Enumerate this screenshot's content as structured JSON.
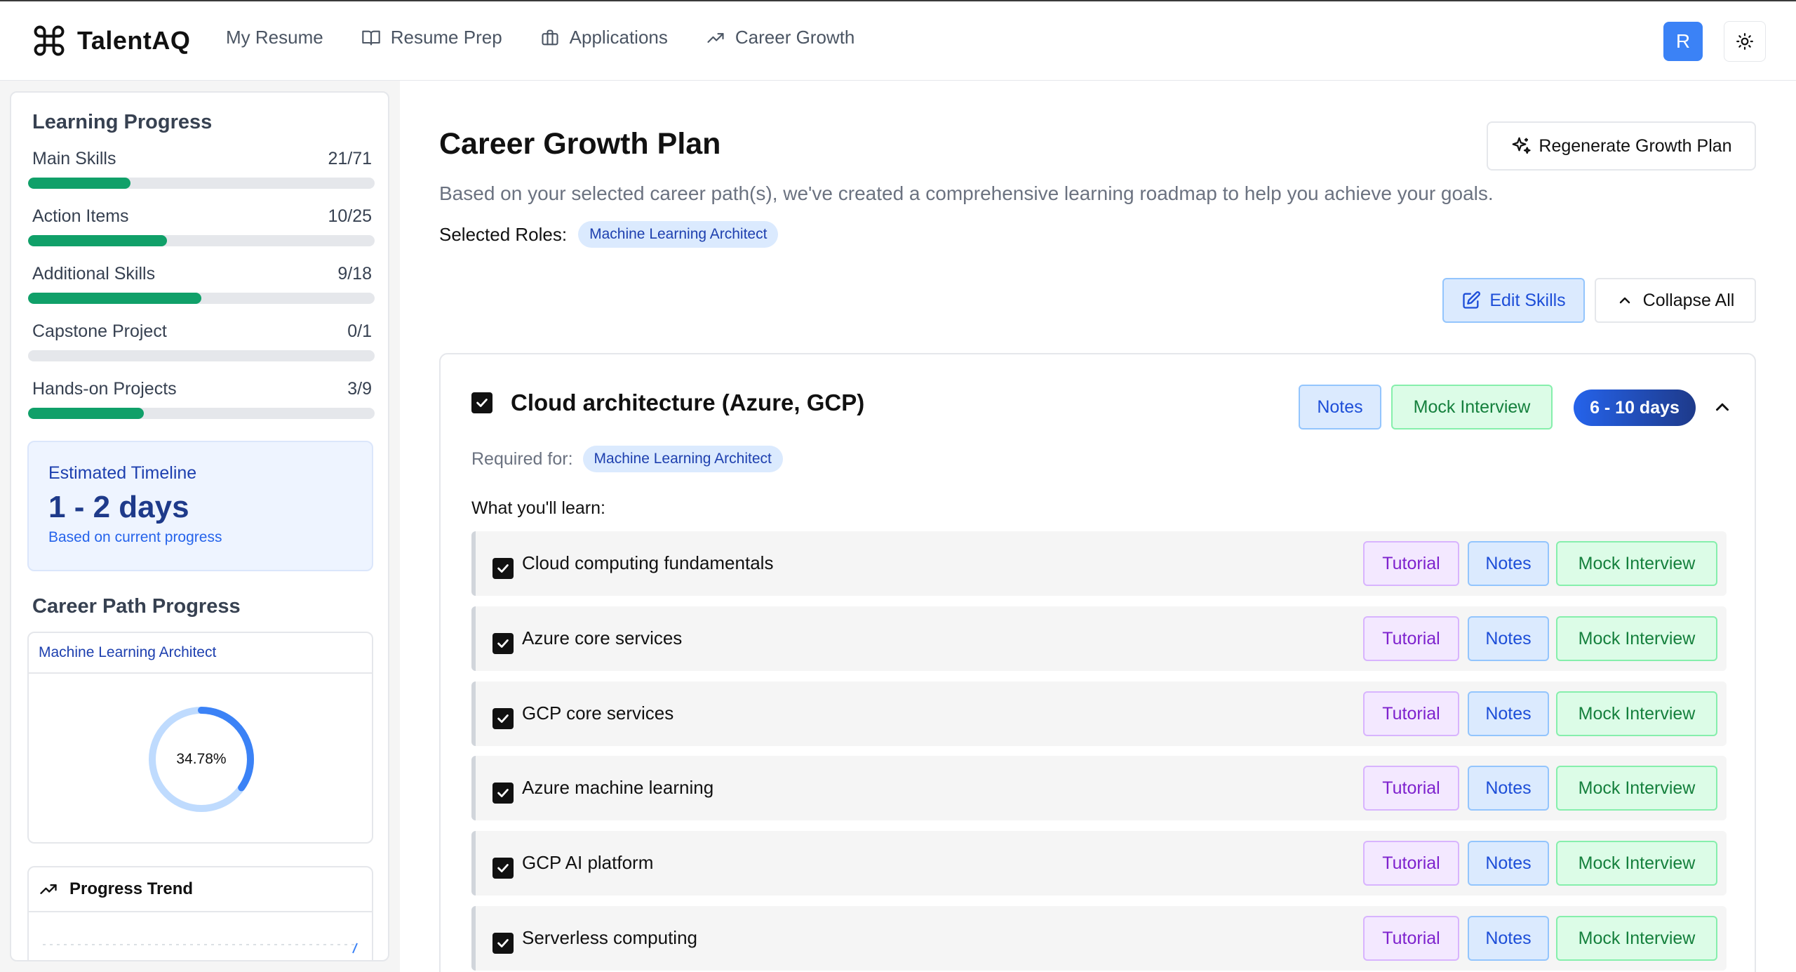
{
  "app": {
    "name": "TalentAQ",
    "avatar_initial": "R"
  },
  "nav": [
    {
      "label": "My Resume",
      "icon": "none"
    },
    {
      "label": "Resume Prep",
      "icon": "book-open-icon"
    },
    {
      "label": "Applications",
      "icon": "briefcase-icon"
    },
    {
      "label": "Career Growth",
      "icon": "trending-up-icon"
    }
  ],
  "sidebar": {
    "learning_title": "Learning Progress",
    "progress": [
      {
        "label": "Main Skills",
        "count": "21/71",
        "fraction": 0.296
      },
      {
        "label": "Action Items",
        "count": "10/25",
        "fraction": 0.4
      },
      {
        "label": "Additional Skills",
        "count": "9/18",
        "fraction": 0.5
      },
      {
        "label": "Capstone Project",
        "count": "0/1",
        "fraction": 0.0
      },
      {
        "label": "Hands-on Projects",
        "count": "3/9",
        "fraction": 0.333
      }
    ],
    "timeline": {
      "label": "Estimated Timeline",
      "value": "1 - 2 days",
      "sub": "Based on current progress"
    },
    "career_path_title": "Career Path Progress",
    "career_path": {
      "role": "Machine Learning Architect",
      "percent_label": "34.78%",
      "fraction": 0.3478
    },
    "trend_title": "Progress Trend"
  },
  "main": {
    "title": "Career Growth Plan",
    "regen_label": "Regenerate Growth Plan",
    "subtitle": "Based on your selected career path(s), we've created a comprehensive learning roadmap to help you achieve your goals.",
    "selected_roles_label": "Selected Roles:",
    "selected_roles": [
      "Machine Learning Architect"
    ],
    "edit_skills_label": "Edit Skills",
    "collapse_all_label": "Collapse All",
    "skill": {
      "name": "Cloud architecture (Azure, GCP)",
      "checked": true,
      "notes_label": "Notes",
      "mock_label": "Mock Interview",
      "days": "6 - 10 days",
      "required_for_label": "Required for:",
      "required_for": "Machine Learning Architect",
      "learn_label": "What you'll learn:",
      "items": [
        {
          "label": "Cloud computing fundamentals",
          "checked": true
        },
        {
          "label": "Azure core services",
          "checked": true
        },
        {
          "label": "GCP core services",
          "checked": true
        },
        {
          "label": "Azure machine learning",
          "checked": true
        },
        {
          "label": "GCP AI platform",
          "checked": true
        },
        {
          "label": "Serverless computing",
          "checked": true
        }
      ],
      "item_buttons": {
        "tutorial": "Tutorial",
        "notes": "Notes",
        "mock": "Mock Interview"
      }
    }
  },
  "colors": {
    "accent": "#3b82f6",
    "progress": "#10a069",
    "tutorial": "#7e22ce",
    "notes": "#1d4ed8",
    "mock": "#15803d"
  }
}
